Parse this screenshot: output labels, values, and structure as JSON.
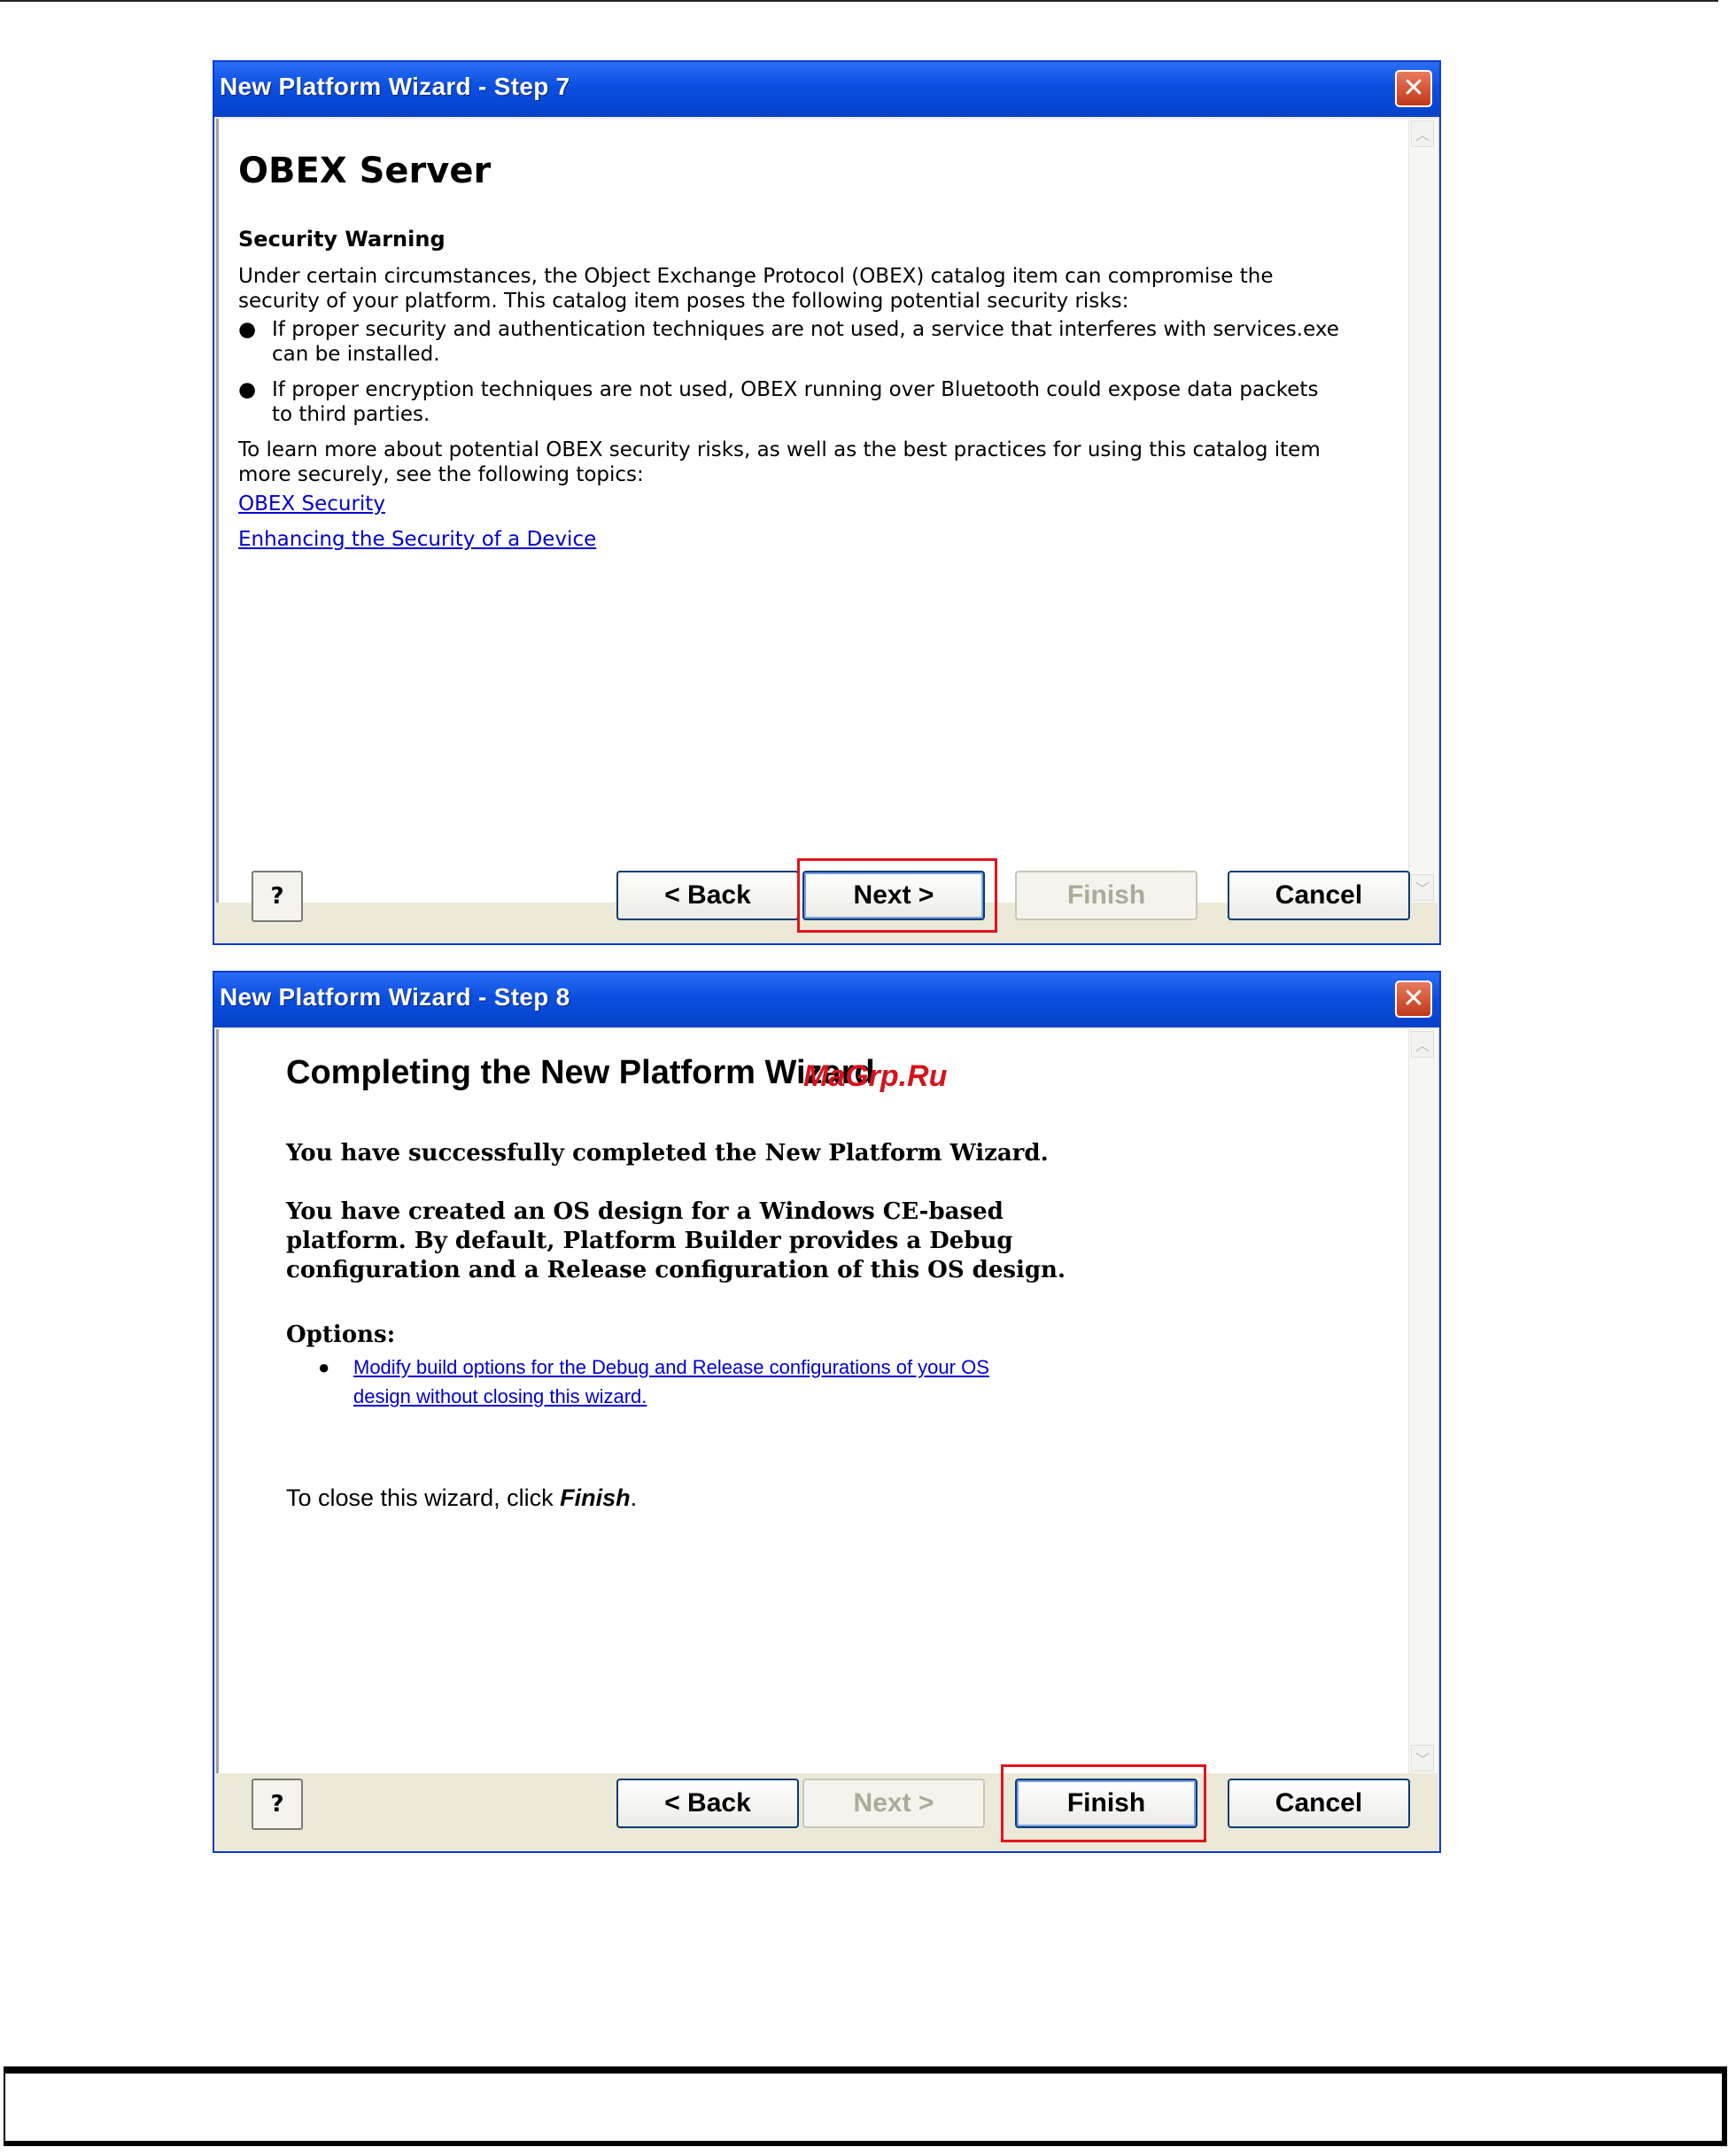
{
  "dialog1": {
    "title": "New Platform Wizard - Step 7",
    "heading": "OBEX Server",
    "subheading": "Security Warning",
    "intro_line1": "Under certain circumstances, the Object Exchange Protocol (OBEX) catalog item can compromise the",
    "intro_line2": "security of your platform. This catalog item poses the following potential security risks:",
    "bullets": [
      {
        "line1": "If proper security and authentication techniques are not used, a service that interferes with services.exe",
        "line2": "can be installed."
      },
      {
        "line1": "If proper encryption techniques are not used, OBEX running over Bluetooth could expose data packets",
        "line2": "to third parties."
      }
    ],
    "outro_line1": "To learn more about potential OBEX security risks, as well as the best practices for using this catalog item",
    "outro_line2": "more securely, see the following topics:",
    "links": [
      "OBEX Security",
      "Enhancing the Security of a Device"
    ],
    "buttons": {
      "back": "< Back",
      "next": "Next >",
      "finish": "Finish",
      "cancel": "Cancel"
    }
  },
  "dialog2": {
    "title": "New Platform Wizard - Step 8",
    "heading": "Completing the New Platform Wizard",
    "watermark": "MaGrp.Ru",
    "para1": "You have successfully completed the New Platform Wizard.",
    "para2_line1": "You have created an OS design for a Windows CE-based",
    "para2_line2": "platform. By default, Platform Builder provides a Debug",
    "para2_line3": "configuration and a Release configuration of this OS design.",
    "options_label": "Options:",
    "option_link_line1": "Modify build options for the Debug and Release configurations of your OS",
    "option_link_line2": "design without closing this wizard.",
    "close_note_prefix": "To close this wizard, click ",
    "close_note_emph": "Finish",
    "close_note_suffix": ".",
    "buttons": {
      "back": "< Back",
      "next": "Next >",
      "finish": "Finish",
      "cancel": "Cancel"
    }
  },
  "icons": {
    "close": "close-x-icon",
    "help": "help-icon",
    "scroll_up": "chevron-up-icon",
    "scroll_down": "chevron-down-icon"
  },
  "colors": {
    "titlebar": "#0b4fe0",
    "highlight": "#e2141b",
    "link": "#0000cc"
  }
}
